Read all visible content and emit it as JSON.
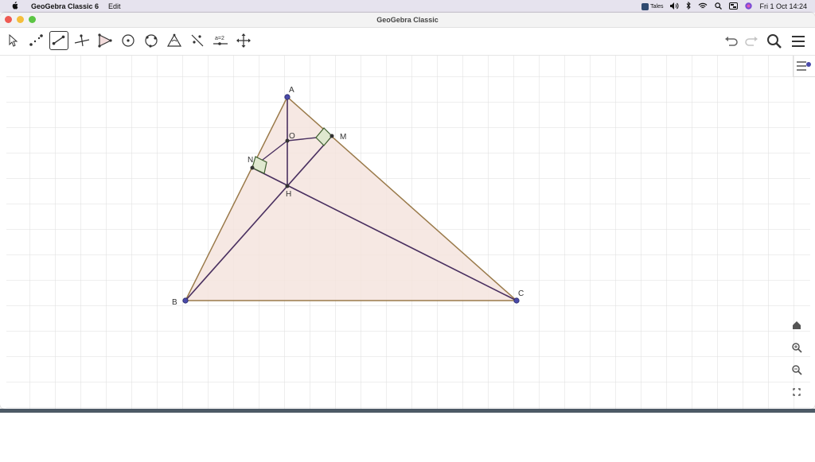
{
  "menubar": {
    "app_name": "GeoGebra Classic 6",
    "menu_edit": "Edit",
    "tales_label": "Tales",
    "date_time": "Fri 1 Oct  14:24"
  },
  "window": {
    "title": "GeoGebra Classic"
  },
  "toolbar": {
    "tools": [
      "move-tool",
      "point-tool",
      "segment-tool",
      "perpendicular-line-tool",
      "polygon-tool",
      "circle-tool",
      "conic-tool",
      "angle-tool",
      "reflect-tool",
      "slider-tool",
      "move-view-tool"
    ],
    "selected_tool": "segment-tool",
    "slider_tool_text": "a=2"
  },
  "colors": {
    "triangle_fill": "#f4e4de",
    "triangle_edge": "#9a7a4a",
    "altitude": "#4a3060",
    "point": "#4a4aaa",
    "right_angle_fill": "#dfe8cf",
    "right_angle_edge": "#3d5e2e",
    "grid": "#dddddd"
  },
  "points": {
    "A": "A",
    "B": "B",
    "C": "C",
    "H": "H",
    "O": "O",
    "M": "M",
    "N": "N"
  }
}
